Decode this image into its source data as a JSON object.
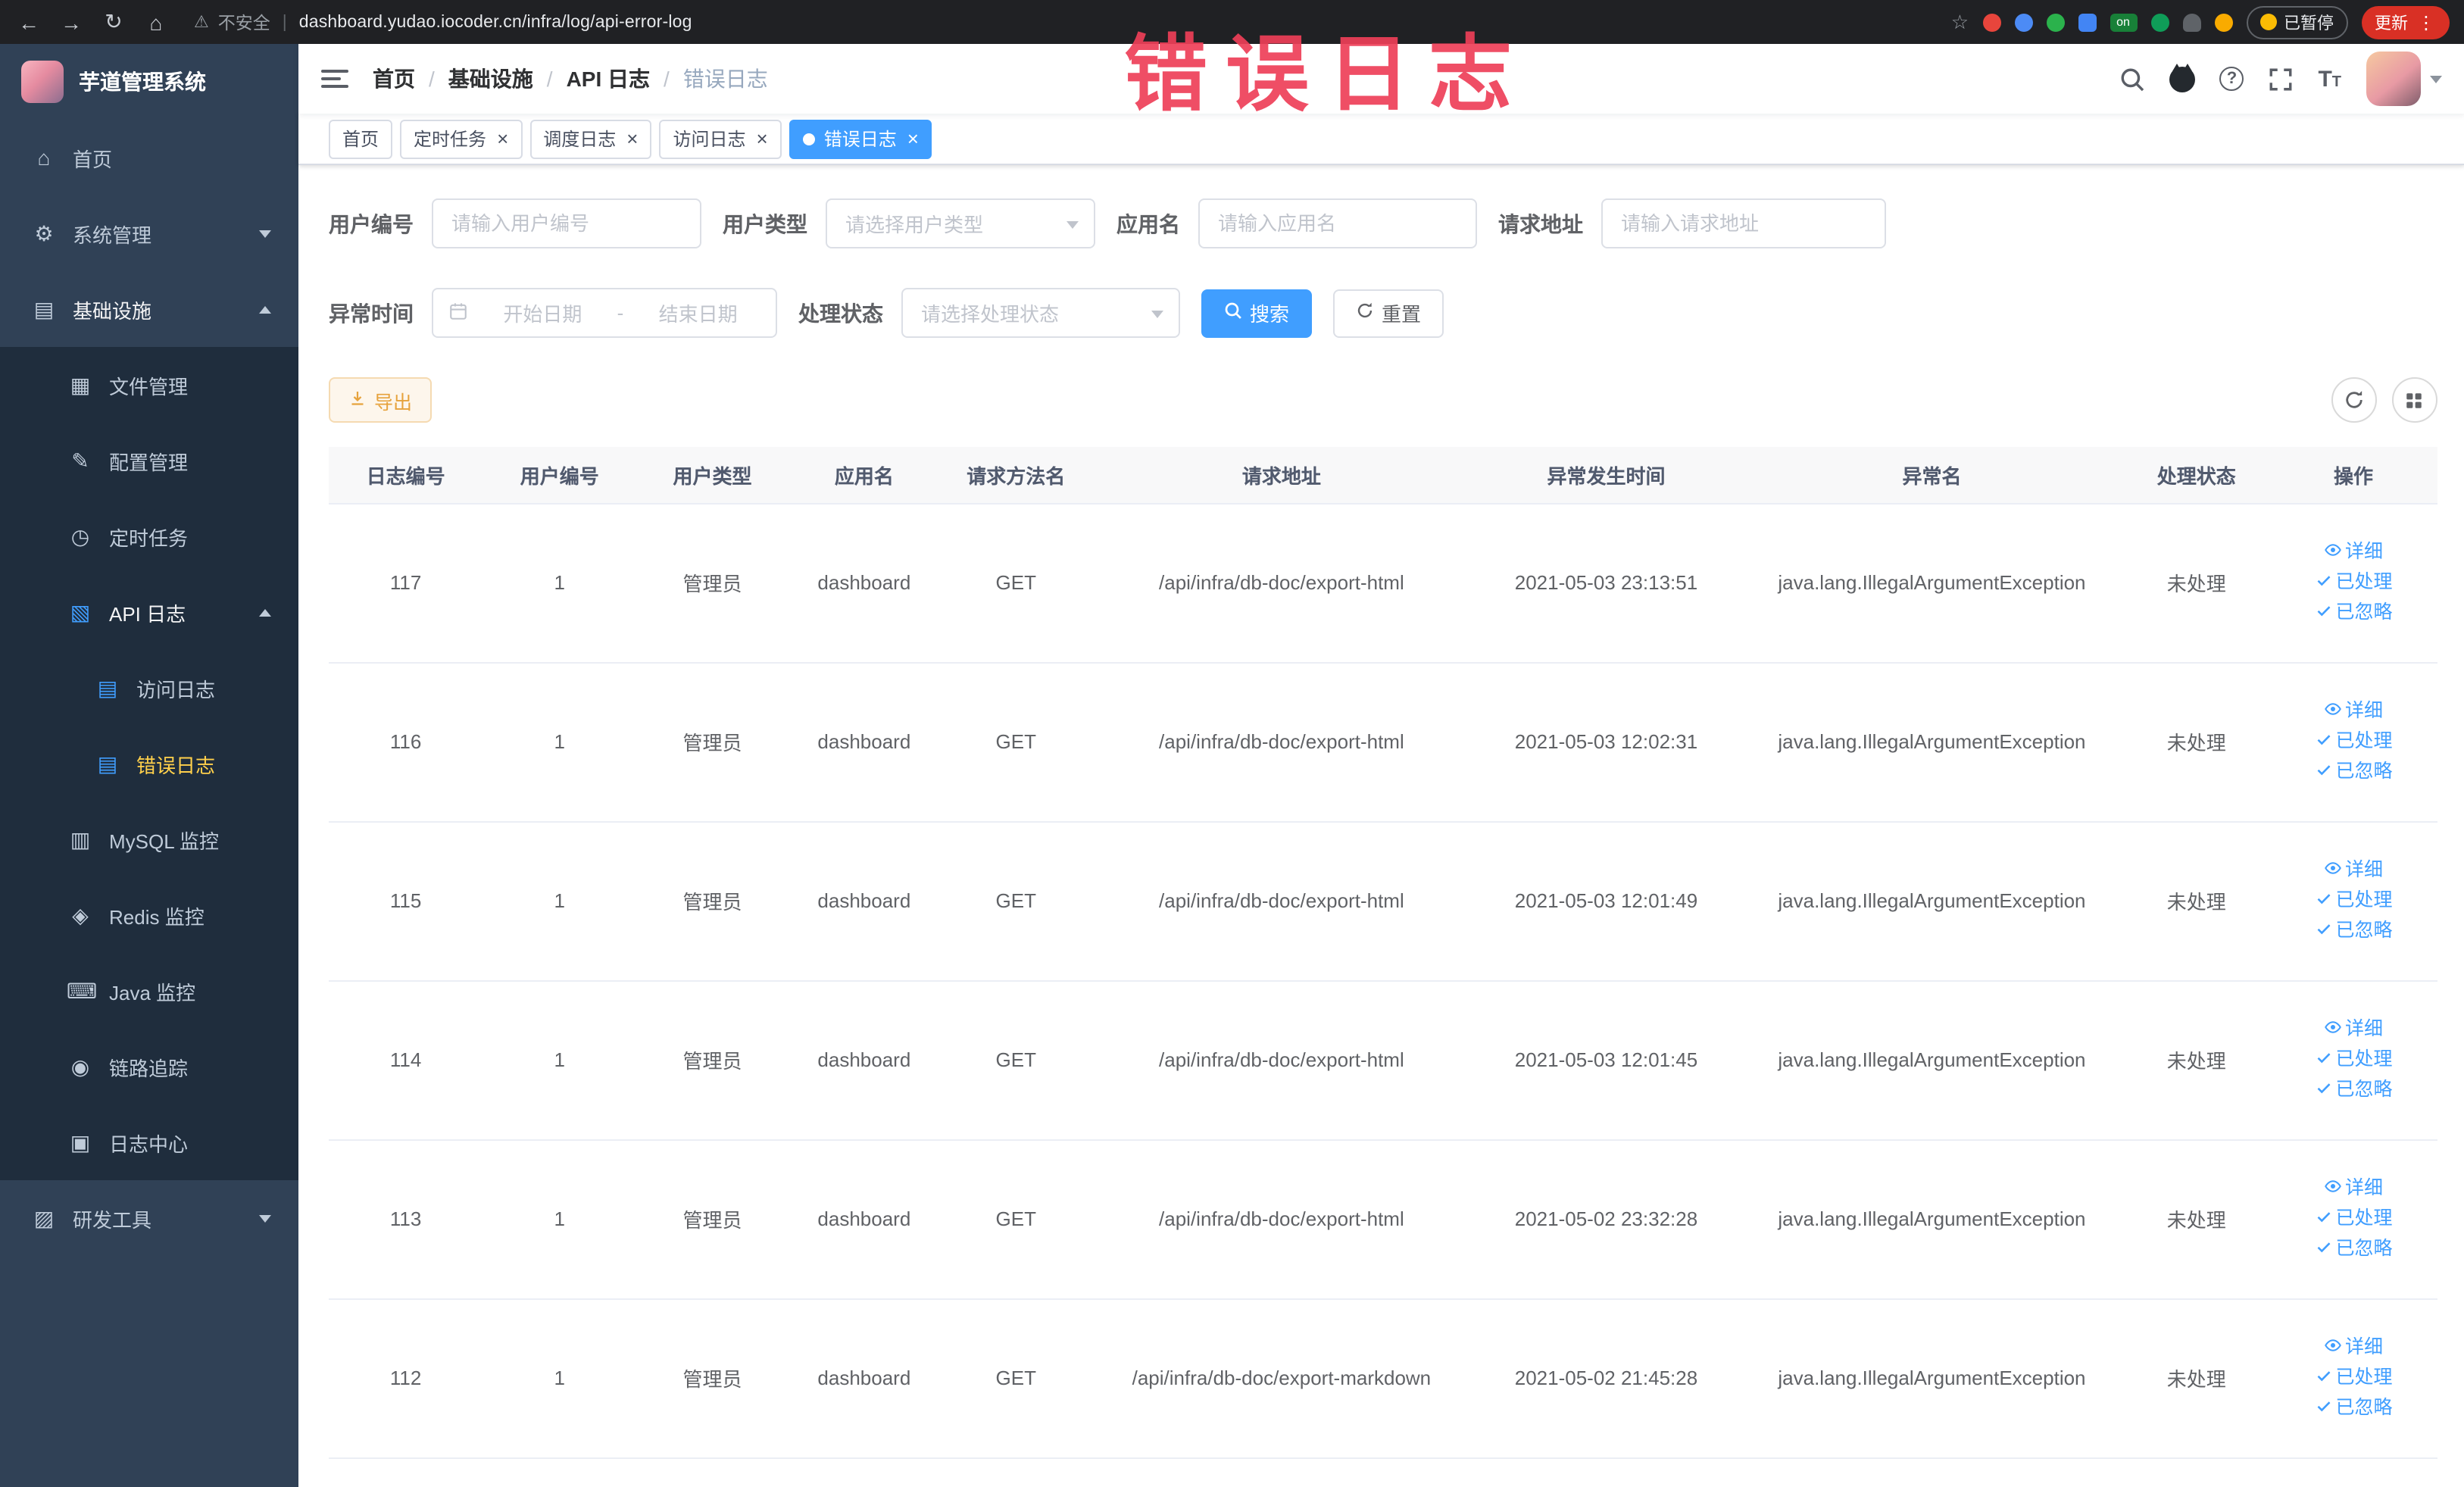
{
  "browser": {
    "security_label": "不安全",
    "url": "dashboard.yudao.iocoder.cn/infra/log/api-error-log",
    "extension_badge": "on",
    "paused_label": "已暂停",
    "update_label": "更新"
  },
  "watermark": "错误日志",
  "sidebar": {
    "logo_title": "芋道管理系统",
    "items": [
      {
        "label": "首页",
        "level": 1,
        "icon": "home-icon",
        "glyph": "⌂"
      },
      {
        "label": "系统管理",
        "level": 1,
        "icon": "gear-icon",
        "glyph": "⚙",
        "chevron": "down"
      },
      {
        "label": "基础设施",
        "level": 1,
        "icon": "infra-icon",
        "glyph": "▤",
        "chevron": "up",
        "open": true
      },
      {
        "label": "文件管理",
        "level": 2,
        "icon": "file-icon",
        "glyph": "▦"
      },
      {
        "label": "配置管理",
        "level": 2,
        "icon": "edit-icon",
        "glyph": "✎"
      },
      {
        "label": "定时任务",
        "level": 2,
        "icon": "timer-icon",
        "glyph": "◷"
      },
      {
        "label": "API 日志",
        "level": 2,
        "icon": "api-log-icon",
        "glyph": "▧",
        "chevron": "up",
        "open": true,
        "iconBlue": true
      },
      {
        "label": "访问日志",
        "level": 3,
        "icon": "access-log-icon",
        "glyph": "▤",
        "iconBlue": true
      },
      {
        "label": "错误日志",
        "level": 3,
        "icon": "error-log-icon",
        "glyph": "▤",
        "iconBlue": true,
        "active": true
      },
      {
        "label": "MySQL 监控",
        "level": 2,
        "icon": "mysql-icon",
        "glyph": "▥"
      },
      {
        "label": "Redis 监控",
        "level": 2,
        "icon": "redis-icon",
        "glyph": "◈"
      },
      {
        "label": "Java 监控",
        "level": 2,
        "icon": "java-icon",
        "glyph": "⌨"
      },
      {
        "label": "链路追踪",
        "level": 2,
        "icon": "trace-icon",
        "glyph": "◉"
      },
      {
        "label": "日志中心",
        "level": 2,
        "icon": "log-center-icon",
        "glyph": "▣"
      },
      {
        "label": "研发工具",
        "level": 1,
        "icon": "tools-icon",
        "glyph": "▨",
        "chevron": "down"
      }
    ]
  },
  "header": {
    "breadcrumb": [
      "首页",
      "基础设施",
      "API 日志",
      "错误日志"
    ]
  },
  "tabs": [
    {
      "label": "首页",
      "closable": false,
      "active": false
    },
    {
      "label": "定时任务",
      "closable": true,
      "active": false
    },
    {
      "label": "调度日志",
      "closable": true,
      "active": false
    },
    {
      "label": "访问日志",
      "closable": true,
      "active": false
    },
    {
      "label": "错误日志",
      "closable": true,
      "active": true
    }
  ],
  "filters": {
    "user_id": {
      "label": "用户编号",
      "placeholder": "请输入用户编号"
    },
    "user_type": {
      "label": "用户类型",
      "placeholder": "请选择用户类型"
    },
    "app_name": {
      "label": "应用名",
      "placeholder": "请输入应用名"
    },
    "request_url": {
      "label": "请求地址",
      "placeholder": "请输入请求地址"
    },
    "exception_time": {
      "label": "异常时间",
      "start_placeholder": "开始日期",
      "separator": "-",
      "end_placeholder": "结束日期"
    },
    "process_status": {
      "label": "处理状态",
      "placeholder": "请选择处理状态"
    },
    "search_label": "搜索",
    "reset_label": "重置"
  },
  "toolbar": {
    "export_label": "导出"
  },
  "table": {
    "columns": [
      "日志编号",
      "用户编号",
      "用户类型",
      "应用名",
      "请求方法名",
      "请求地址",
      "异常发生时间",
      "异常名",
      "处理状态",
      "操作"
    ],
    "rows": [
      [
        "117",
        "1",
        "管理员",
        "dashboard",
        "GET",
        "/api/infra/db-doc/export-html",
        "2021-05-03 23:13:51",
        "java.lang.IllegalArgumentException",
        "未处理"
      ],
      [
        "116",
        "1",
        "管理员",
        "dashboard",
        "GET",
        "/api/infra/db-doc/export-html",
        "2021-05-03 12:02:31",
        "java.lang.IllegalArgumentException",
        "未处理"
      ],
      [
        "115",
        "1",
        "管理员",
        "dashboard",
        "GET",
        "/api/infra/db-doc/export-html",
        "2021-05-03 12:01:49",
        "java.lang.IllegalArgumentException",
        "未处理"
      ],
      [
        "114",
        "1",
        "管理员",
        "dashboard",
        "GET",
        "/api/infra/db-doc/export-html",
        "2021-05-03 12:01:45",
        "java.lang.IllegalArgumentException",
        "未处理"
      ],
      [
        "113",
        "1",
        "管理员",
        "dashboard",
        "GET",
        "/api/infra/db-doc/export-html",
        "2021-05-02 23:32:28",
        "java.lang.IllegalArgumentException",
        "未处理"
      ],
      [
        "112",
        "1",
        "管理员",
        "dashboard",
        "GET",
        "/api/infra/db-doc/export-markdown",
        "2021-05-02 21:45:28",
        "java.lang.IllegalArgumentException",
        "未处理"
      ]
    ],
    "row_actions": [
      {
        "label": "详细",
        "icon": "view-icon"
      },
      {
        "label": "已处理",
        "icon": "check-icon"
      },
      {
        "label": "已忽略",
        "icon": "check-icon"
      }
    ]
  }
}
